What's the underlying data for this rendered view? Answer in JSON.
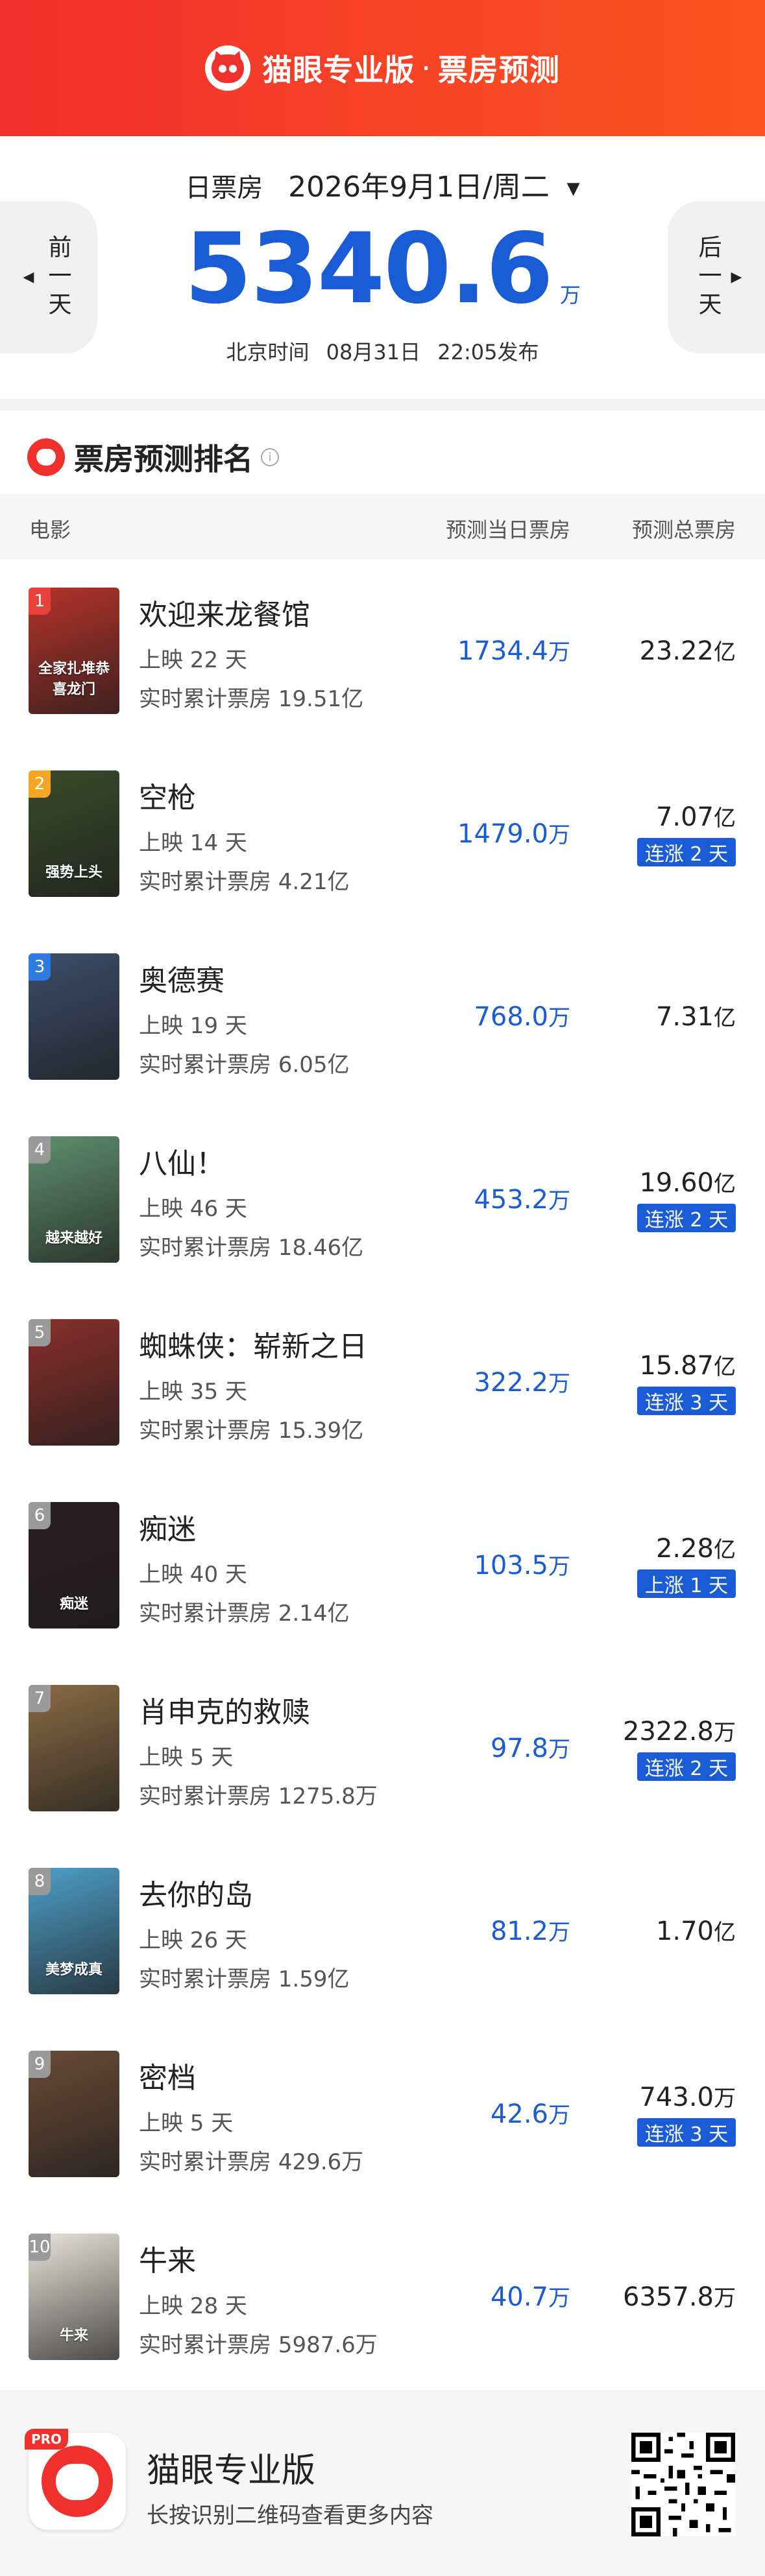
{
  "header": {
    "brand": "猫眼专业版",
    "separator": "·",
    "section": "票房预测"
  },
  "date_card": {
    "label": "日票房",
    "date": "2026年9月1日/周二",
    "total_value": "5340.6",
    "total_unit": "万",
    "pub_prefix": "北京时间",
    "pub_date": "08月31日",
    "pub_time": "22:05发布",
    "prev_label": "前一天",
    "next_label": "后一天"
  },
  "ranking": {
    "title": "票房预测排名",
    "info_icon": "i",
    "columns": [
      "电影",
      "预测当日票房",
      "预测总票房"
    ]
  },
  "movies": [
    {
      "rank": "1",
      "name": "欢迎来龙餐馆",
      "days": "上映 22 天",
      "cumulative": "实时累计票房 19.51亿",
      "day_value": "1734.4",
      "day_unit": "万",
      "total_value": "23.22",
      "total_unit": "亿",
      "badge": "",
      "poster_text": "全家扎堆恭喜龙门",
      "poster_color": "#b5322a"
    },
    {
      "rank": "2",
      "name": "空枪",
      "days": "上映 14 天",
      "cumulative": "实时累计票房 4.21亿",
      "day_value": "1479.0",
      "day_unit": "万",
      "total_value": "7.07",
      "total_unit": "亿",
      "badge": "连涨 2 天",
      "poster_text": "强势上头",
      "poster_color": "#3a4a2a"
    },
    {
      "rank": "3",
      "name": "奥德赛",
      "days": "上映 19 天",
      "cumulative": "实时累计票房 6.05亿",
      "day_value": "768.0",
      "day_unit": "万",
      "total_value": "7.31",
      "total_unit": "亿",
      "badge": "",
      "poster_text": "",
      "poster_color": "#3c4d6b"
    },
    {
      "rank": "4",
      "name": "八仙！",
      "days": "上映 46 天",
      "cumulative": "实时累计票房 18.46亿",
      "day_value": "453.2",
      "day_unit": "万",
      "total_value": "19.60",
      "total_unit": "亿",
      "badge": "连涨 2 天",
      "poster_text": "越来越好",
      "poster_color": "#5f8f6e"
    },
    {
      "rank": "5",
      "name": "蜘蛛侠：崭新之日",
      "days": "上映 35 天",
      "cumulative": "实时累计票房 15.39亿",
      "day_value": "322.2",
      "day_unit": "万",
      "total_value": "15.87",
      "total_unit": "亿",
      "badge": "连涨 3 天",
      "poster_text": "",
      "poster_color": "#8a2f2a"
    },
    {
      "rank": "6",
      "name": "痴迷",
      "days": "上映 40 天",
      "cumulative": "实时累计票房 2.14亿",
      "day_value": "103.5",
      "day_unit": "万",
      "total_value": "2.28",
      "total_unit": "亿",
      "badge": "上涨 1 天",
      "poster_text": "痴迷",
      "poster_color": "#2a1e22"
    },
    {
      "rank": "7",
      "name": "肖申克的救赎",
      "days": "上映 5 天",
      "cumulative": "实时累计票房 1275.8万",
      "day_value": "97.8",
      "day_unit": "万",
      "total_value": "2322.8",
      "total_unit": "万",
      "badge": "连涨 2 天",
      "poster_text": "",
      "poster_color": "#8a6a44"
    },
    {
      "rank": "8",
      "name": "去你的岛",
      "days": "上映 26 天",
      "cumulative": "实时累计票房 1.59亿",
      "day_value": "81.2",
      "day_unit": "万",
      "total_value": "1.70",
      "total_unit": "亿",
      "badge": "",
      "poster_text": "美梦成真",
      "poster_color": "#4e9fc9"
    },
    {
      "rank": "9",
      "name": "密档",
      "days": "上映 5 天",
      "cumulative": "实时累计票房 429.6万",
      "day_value": "42.6",
      "day_unit": "万",
      "total_value": "743.0",
      "total_unit": "万",
      "badge": "连涨 3 天",
      "poster_text": "",
      "poster_color": "#6a4a36"
    },
    {
      "rank": "10",
      "name": "牛来",
      "days": "上映 28 天",
      "cumulative": "实时累计票房 5987.6万",
      "day_value": "40.7",
      "day_unit": "万",
      "total_value": "6357.8",
      "total_unit": "万",
      "badge": "",
      "poster_text": "牛来",
      "poster_color": "#e9e4dc"
    }
  ],
  "footer": {
    "app_name": "猫眼专业版",
    "hint": "长按识别二维码查看更多内容",
    "pro_badge": "PRO"
  },
  "colors": {
    "brand_red": "#f0302d",
    "accent_blue": "#1a5bd6"
  }
}
